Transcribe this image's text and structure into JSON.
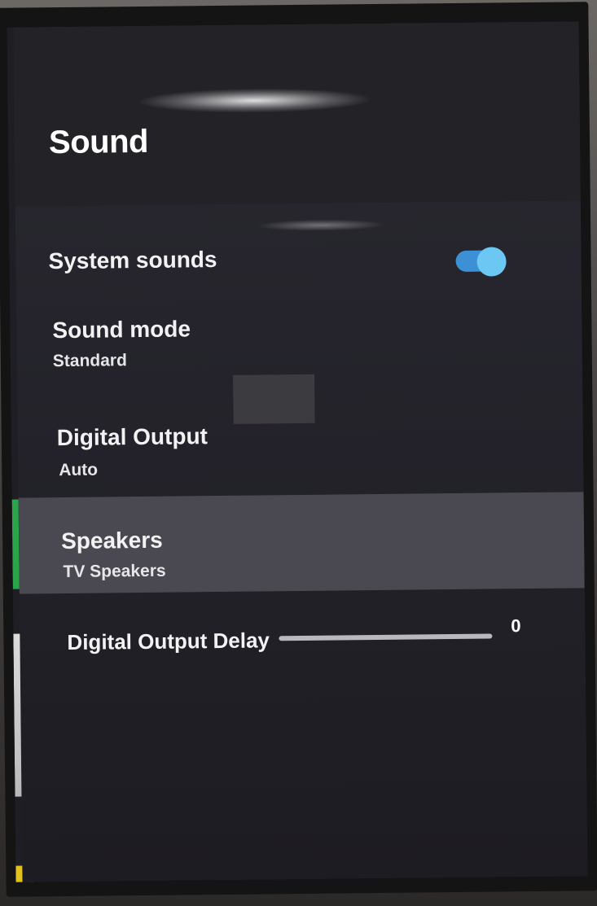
{
  "page": {
    "title": "Sound"
  },
  "settings": [
    {
      "title": "System sounds",
      "type": "toggle",
      "toggle_on": true
    },
    {
      "title": "Sound mode",
      "subtitle": "Standard",
      "type": "menu"
    },
    {
      "title": "Digital Output",
      "subtitle": "Auto",
      "type": "menu"
    },
    {
      "title": "Speakers",
      "subtitle": "TV Speakers",
      "type": "menu",
      "selected": true
    },
    {
      "title": "Digital Output Delay",
      "type": "slider",
      "value": "0"
    }
  ],
  "colors": {
    "panel_background": "#25242c",
    "selected_row": "#4a4952",
    "toggle_track": "#3d8fd6",
    "toggle_knob": "#6cc7f2",
    "text": "#ffffff"
  }
}
